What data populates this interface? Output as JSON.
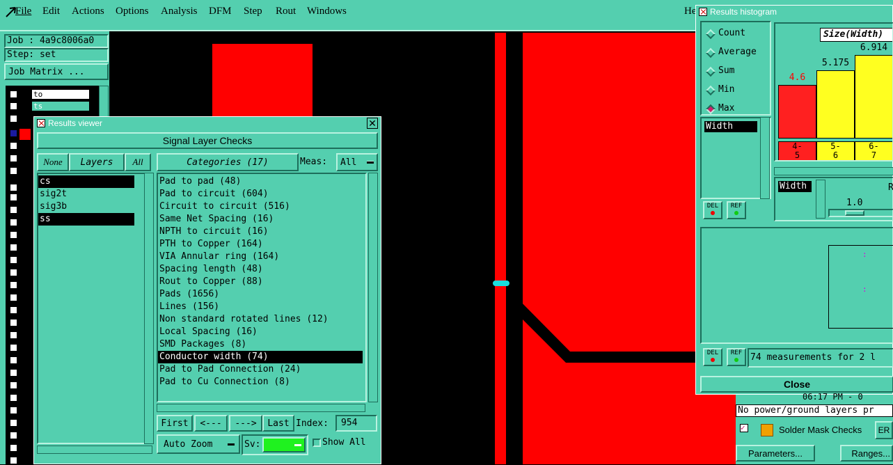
{
  "menu": {
    "items": [
      "File",
      "Edit",
      "Actions",
      "Options",
      "Analysis",
      "DFM",
      "Step",
      "Rout",
      "Windows"
    ],
    "help_partial": "He"
  },
  "left_panel": {
    "job": "Job : 4a9c8006a0",
    "step": "Step: set",
    "job_matrix": "Job Matrix ...",
    "layer_rows": [
      {
        "name": "to",
        "style": "white"
      },
      {
        "name": "ts",
        "style": "teal"
      }
    ]
  },
  "results_viewer": {
    "title": "Results viewer",
    "header": "Signal Layer Checks",
    "none_label": "None",
    "layers_label": "Layers",
    "all_label": "All",
    "categories_label": "Categories (17)",
    "meas_label": "Meas:",
    "meas_value": "All",
    "layers": [
      {
        "name": "cs",
        "selected": true
      },
      {
        "name": "sig2t",
        "selected": false
      },
      {
        "name": "sig3b",
        "selected": false
      },
      {
        "name": "ss",
        "selected": true
      }
    ],
    "categories": [
      {
        "label": "Pad to pad (48)",
        "selected": false
      },
      {
        "label": "Pad to circuit (604)",
        "selected": false
      },
      {
        "label": "Circuit to circuit (516)",
        "selected": false
      },
      {
        "label": "Same Net Spacing (16)",
        "selected": false
      },
      {
        "label": "NPTH to circuit (16)",
        "selected": false
      },
      {
        "label": "PTH to Copper (164)",
        "selected": false
      },
      {
        "label": "VIA Annular ring (164)",
        "selected": false
      },
      {
        "label": "Spacing length (48)",
        "selected": false
      },
      {
        "label": "Rout to Copper (88)",
        "selected": false
      },
      {
        "label": "Pads (1656)",
        "selected": false
      },
      {
        "label": "Lines (156)",
        "selected": false
      },
      {
        "label": "Non standard rotated lines (12)",
        "selected": false
      },
      {
        "label": "Local Spacing (16)",
        "selected": false
      },
      {
        "label": "SMD Packages (8)",
        "selected": false
      },
      {
        "label": "Conductor width (74)",
        "selected": true
      },
      {
        "label": "Pad to Pad Connection (24)",
        "selected": false
      },
      {
        "label": "Pad to Cu Connection (8)",
        "selected": false
      }
    ],
    "first_label": "First",
    "prev_label": "<---",
    "next_label": "--->",
    "last_label": "Last",
    "index_label": "Index:",
    "index_value": "954",
    "auto_zoom_label": "Auto Zoom",
    "sv_label": "Sv:",
    "show_all_label": "Show All"
  },
  "histogram": {
    "title": "Results histogram",
    "options": [
      {
        "label": "Count",
        "selected": false
      },
      {
        "label": "Average",
        "selected": false
      },
      {
        "label": "Sum",
        "selected": false
      },
      {
        "label": "Min",
        "selected": false
      },
      {
        "label": "Max",
        "selected": true
      }
    ],
    "field_label": "Width",
    "size_label": "Size(Width)",
    "bars": [
      {
        "value": "4.6",
        "range_top": "4-",
        "range_bottom": "5",
        "color": "#ff2020",
        "label_color": "#ff0000",
        "ratio": 0.5
      },
      {
        "value": "5.175",
        "range_top": "5-",
        "range_bottom": "6",
        "color": "#ffff20",
        "label_color": "#000000",
        "ratio": 0.634
      },
      {
        "value": "6.914",
        "range_top": "6-",
        "range_bottom": "7",
        "color": "#ffff20",
        "label_color": "#000000",
        "ratio": 0.78
      }
    ],
    "width_label2": "Width",
    "scale_value": "1.0",
    "scale_partial": "R",
    "del_label": "DEL",
    "ref_label": "REF",
    "measurements_text": "74 measurements for 2 l",
    "close_label": "Close"
  },
  "erc_panel": {
    "time_text": "06:17 PM - 0",
    "status_text": "No power/ground layers pr",
    "solder_mask_label": "Solder Mask Checks",
    "er_label": "ER",
    "parameters_label": "Parameters...",
    "ranges_label": "Ranges..."
  }
}
